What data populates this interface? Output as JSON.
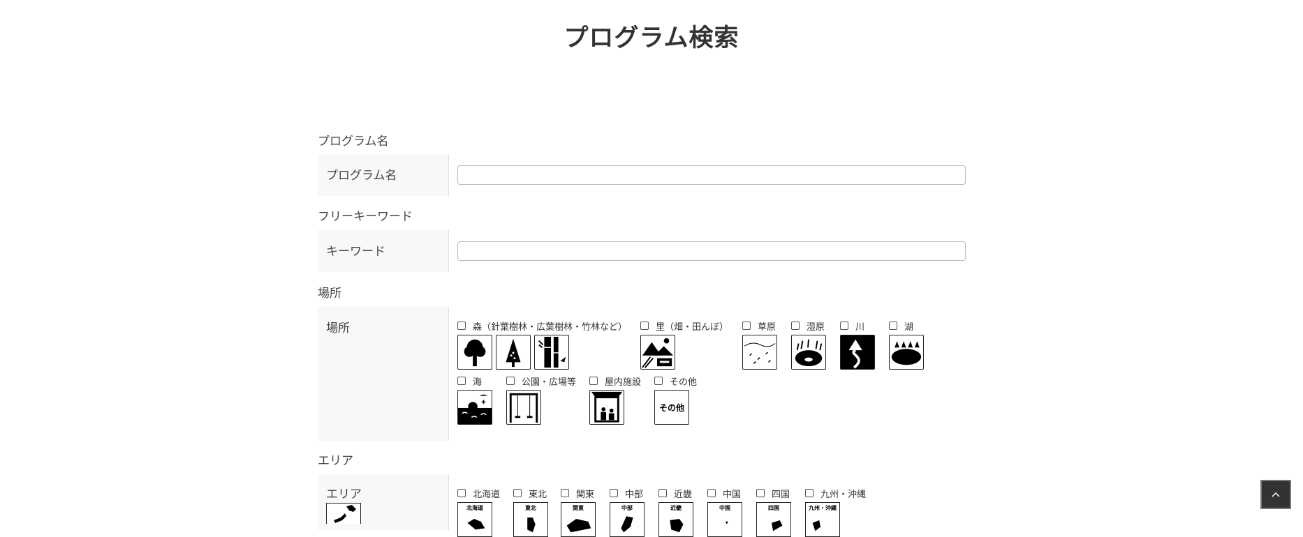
{
  "page": {
    "title": "プログラム検索"
  },
  "program_name": {
    "section": "プログラム名",
    "label": "プログラム名",
    "value": "",
    "placeholder": ""
  },
  "keyword": {
    "section": "フリーキーワード",
    "label": "キーワード",
    "value": "",
    "placeholder": ""
  },
  "place": {
    "section": "場所",
    "label": "場所",
    "options": [
      {
        "label": "森（針葉樹林・広葉樹林・竹林など）",
        "icons": [
          "broadleaf-tree-icon",
          "conifer-tree-icon",
          "bamboo-icon"
        ]
      },
      {
        "label": "里（畑・田んぼ）",
        "icons": [
          "satoyama-village-icon"
        ]
      },
      {
        "label": "草原",
        "icons": [
          "grassland-icon"
        ]
      },
      {
        "label": "湿原",
        "icons": [
          "wetland-icon"
        ]
      },
      {
        "label": "川",
        "icons": [
          "river-icon"
        ]
      },
      {
        "label": "湖",
        "icons": [
          "lake-icon"
        ]
      },
      {
        "label": "海",
        "icons": [
          "sea-icon"
        ]
      },
      {
        "label": "公園・広場等",
        "icons": [
          "park-swing-icon"
        ]
      },
      {
        "label": "屋内施設",
        "icons": [
          "indoor-facility-icon"
        ]
      },
      {
        "label": "その他",
        "icons": [
          "other-icon"
        ],
        "icon_text": "その他"
      }
    ]
  },
  "area": {
    "section": "エリア",
    "label": "エリア",
    "label_icon": "japan-map-icon",
    "options": [
      {
        "label": "北海道",
        "icon_text": "北海道",
        "icon": "hokkaido-map-icon"
      },
      {
        "label": "東北",
        "icon_text": "東北",
        "icon": "tohoku-map-icon"
      },
      {
        "label": "関東",
        "icon_text": "関東",
        "icon": "kanto-map-icon"
      },
      {
        "label": "中部",
        "icon_text": "中部",
        "icon": "chubu-map-icon"
      },
      {
        "label": "近畿",
        "icon_text": "近畿",
        "icon": "kinki-map-icon"
      },
      {
        "label": "中国",
        "icon_text": "中国",
        "icon": "chugoku-map-icon"
      },
      {
        "label": "四国",
        "icon_text": "四国",
        "icon": "shikoku-map-icon"
      },
      {
        "label": "九州・沖縄",
        "icon_text": "九州・沖縄",
        "icon": "kyushu-okinawa-map-icon"
      }
    ]
  },
  "scroll_top": {
    "icon": "chevron-up-icon"
  }
}
